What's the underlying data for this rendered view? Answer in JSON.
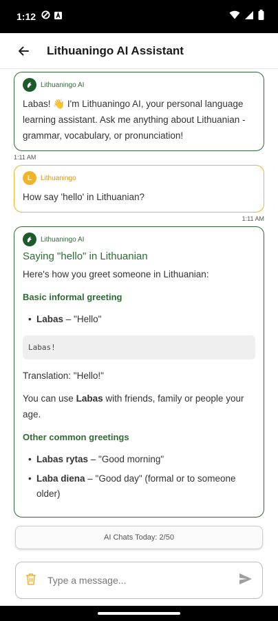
{
  "status_bar": {
    "time": "1:12",
    "icons": [
      "data-saver-icon",
      "notification-a-icon",
      "wifi-icon",
      "signal-icon",
      "battery-icon"
    ]
  },
  "app_bar": {
    "title": "Lithuaningo AI Assistant",
    "back_icon": "arrow-left-icon"
  },
  "messages": [
    {
      "sender": "Lithuaningo AI",
      "text": "Labas! 👋 I'm Lithuaningo AI, your personal language learning assistant. Ask me anything about Lithuanian - grammar, vocabulary, or pronunciation!",
      "time": "1:11 AM"
    },
    {
      "sender": "Lithuaningo",
      "avatar_letter": "L",
      "text": "How say 'hello' in Lithuanian?",
      "time": "1:11 AM"
    },
    {
      "sender": "Lithuaningo AI",
      "heading": "Saying \"hello\" in Lithuanian",
      "intro": "Here's how you greet someone in Lithuanian:",
      "section1_title": "Basic informal greeting",
      "section1_items": [
        {
          "term": "Labas",
          "meaning": " – \"Hello\""
        }
      ],
      "code": "Labas!",
      "translation": "Translation: \"Hello!\"",
      "usage_pre": "You can use ",
      "usage_term": "Labas",
      "usage_post": " with friends, family or people your age.",
      "section2_title": "Other common greetings",
      "section2_items": [
        {
          "term": "Labas rytas",
          "meaning": " – \"Good morning\""
        },
        {
          "term": "Laba diena",
          "meaning": " – \"Good day\" (formal or to someone older)"
        }
      ]
    }
  ],
  "counter": {
    "label": "AI Chats Today: 2/50"
  },
  "input": {
    "placeholder": "Type a message...",
    "delete_icon": "trash-icon",
    "send_icon": "send-icon"
  },
  "colors": {
    "ai_green": "#2e6b34",
    "user_amber": "#f0b429"
  }
}
